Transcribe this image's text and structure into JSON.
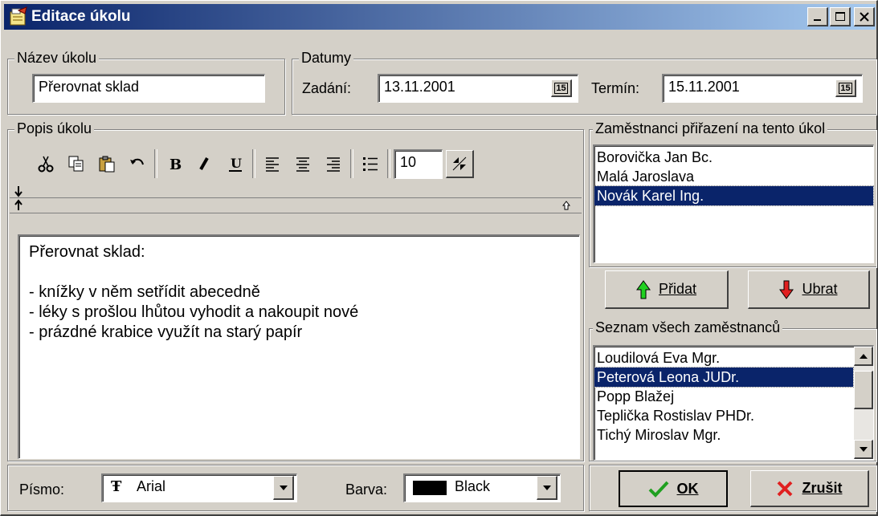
{
  "window": {
    "title": "Editace úkolu"
  },
  "task_name": {
    "legend": "Název úkolu",
    "value": "Přerovnat sklad"
  },
  "dates": {
    "legend": "Datumy",
    "assigned_label": "Zadání:",
    "assigned_value": "13.11.2001",
    "deadline_label": "Termín:",
    "deadline_value": "15.11.2001",
    "calendar_label": "15"
  },
  "description": {
    "legend": "Popis úkolu",
    "font_size": "10",
    "lines": [
      "Přerovnat sklad:",
      "",
      "- knížky v něm setřídit abecedně",
      "- léky s prošlou lhůtou vyhodit a nakoupit nové",
      "- prázdné krabice využít na starý papír"
    ]
  },
  "assigned": {
    "legend": "Zaměstnanci přiřazení na tento úkol",
    "items": [
      "Borovička Jan Bc.",
      "Malá Jaroslava",
      "Novák Karel Ing."
    ],
    "selected": 2
  },
  "buttons": {
    "add": "Přidat",
    "remove": "Ubrat",
    "ok": "OK",
    "cancel": "Zrušit"
  },
  "all_employees": {
    "legend": "Seznam všech zaměstnanců",
    "items": [
      "Loudilová Eva Mgr.",
      "Peterová Leona JUDr.",
      "Popp Blažej",
      "Teplička Rostislav PHDr.",
      "Tichý Miroslav Mgr."
    ],
    "selected": 1
  },
  "footer": {
    "font_label": "Písmo:",
    "font_value": "Arial",
    "color_label": "Barva:",
    "color_value": "Black"
  },
  "colors": {
    "selection": "#0a246a",
    "title_start": "#0a246a",
    "title_end": "#a6caf0",
    "face": "#d4d0c8"
  }
}
